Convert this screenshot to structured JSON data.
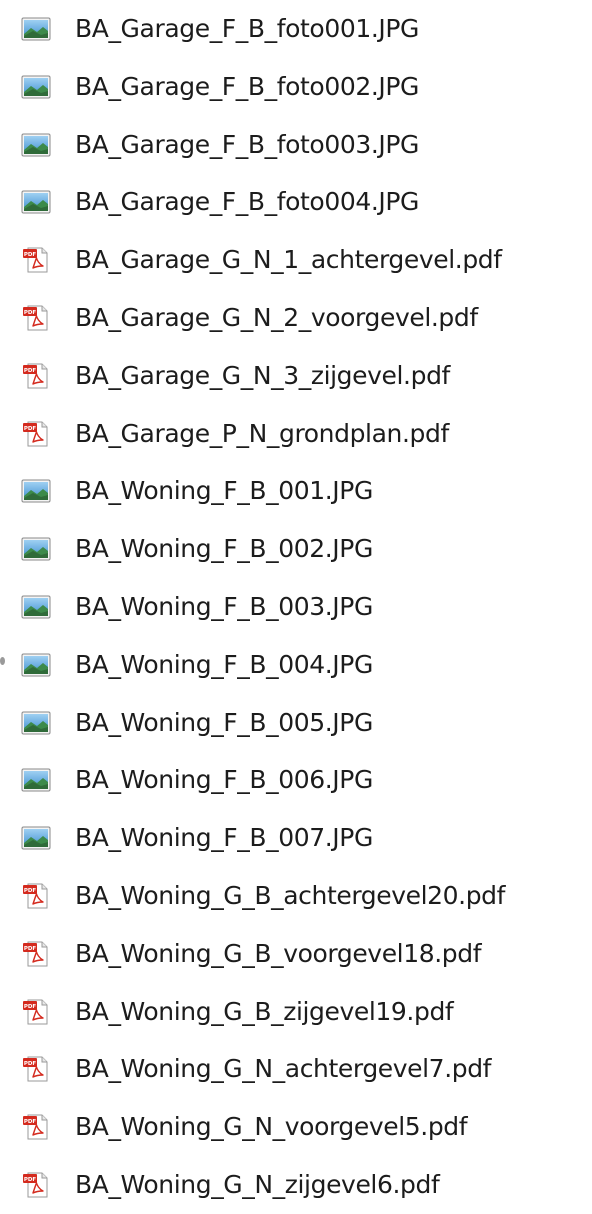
{
  "colors": {
    "text": "#1c1c1c",
    "pdf_red": "#d42a1e",
    "image_blue": "#3f8fd0",
    "image_green": "#3c8a4a"
  },
  "files": [
    {
      "name": "BA_Garage_F_B_foto001.JPG",
      "type": "image",
      "icon": "image-file-icon"
    },
    {
      "name": "BA_Garage_F_B_foto002.JPG",
      "type": "image",
      "icon": "image-file-icon"
    },
    {
      "name": "BA_Garage_F_B_foto003.JPG",
      "type": "image",
      "icon": "image-file-icon"
    },
    {
      "name": "BA_Garage_F_B_foto004.JPG",
      "type": "image",
      "icon": "image-file-icon"
    },
    {
      "name": "BA_Garage_G_N_1_achtergevel.pdf",
      "type": "pdf",
      "icon": "pdf-file-icon"
    },
    {
      "name": "BA_Garage_G_N_2_voorgevel.pdf",
      "type": "pdf",
      "icon": "pdf-file-icon"
    },
    {
      "name": "BA_Garage_G_N_3_zijgevel.pdf",
      "type": "pdf",
      "icon": "pdf-file-icon"
    },
    {
      "name": "BA_Garage_P_N_grondplan.pdf",
      "type": "pdf",
      "icon": "pdf-file-icon"
    },
    {
      "name": "BA_Woning_F_B_001.JPG",
      "type": "image",
      "icon": "image-file-icon"
    },
    {
      "name": "BA_Woning_F_B_002.JPG",
      "type": "image",
      "icon": "image-file-icon"
    },
    {
      "name": "BA_Woning_F_B_003.JPG",
      "type": "image",
      "icon": "image-file-icon"
    },
    {
      "name": "BA_Woning_F_B_004.JPG",
      "type": "image",
      "icon": "image-file-icon"
    },
    {
      "name": "BA_Woning_F_B_005.JPG",
      "type": "image",
      "icon": "image-file-icon"
    },
    {
      "name": "BA_Woning_F_B_006.JPG",
      "type": "image",
      "icon": "image-file-icon"
    },
    {
      "name": "BA_Woning_F_B_007.JPG",
      "type": "image",
      "icon": "image-file-icon"
    },
    {
      "name": "BA_Woning_G_B_achtergevel20.pdf",
      "type": "pdf",
      "icon": "pdf-file-icon"
    },
    {
      "name": "BA_Woning_G_B_voorgevel18.pdf",
      "type": "pdf",
      "icon": "pdf-file-icon"
    },
    {
      "name": "BA_Woning_G_B_zijgevel19.pdf",
      "type": "pdf",
      "icon": "pdf-file-icon"
    },
    {
      "name": "BA_Woning_G_N_achtergevel7.pdf",
      "type": "pdf",
      "icon": "pdf-file-icon"
    },
    {
      "name": "BA_Woning_G_N_voorgevel5.pdf",
      "type": "pdf",
      "icon": "pdf-file-icon"
    },
    {
      "name": "BA_Woning_G_N_zijgevel6.pdf",
      "type": "pdf",
      "icon": "pdf-file-icon"
    }
  ]
}
